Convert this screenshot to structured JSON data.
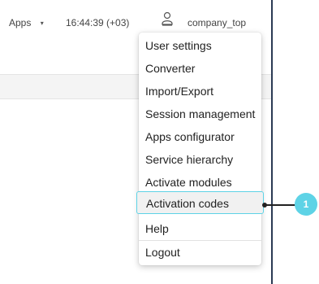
{
  "header": {
    "apps_label": "Apps",
    "apps_caret": "▾",
    "clock": "16:44:39 (+03)",
    "user_icon": "user-icon",
    "username": "company_top"
  },
  "menu": {
    "items": [
      {
        "label": "User settings"
      },
      {
        "label": "Converter"
      },
      {
        "label": "Import/Export"
      },
      {
        "label": "Session management"
      },
      {
        "label": "Apps configurator"
      },
      {
        "label": "Service hierarchy"
      },
      {
        "label": "Activate modules"
      },
      {
        "label": "Activation codes"
      },
      {
        "label": "Help"
      },
      {
        "label": "Logout"
      }
    ]
  },
  "callout": {
    "number": "1"
  },
  "colors": {
    "accent": "#5ed3e6",
    "panel_border": "#2b3b54",
    "highlight_bg": "#f1f1f1"
  }
}
